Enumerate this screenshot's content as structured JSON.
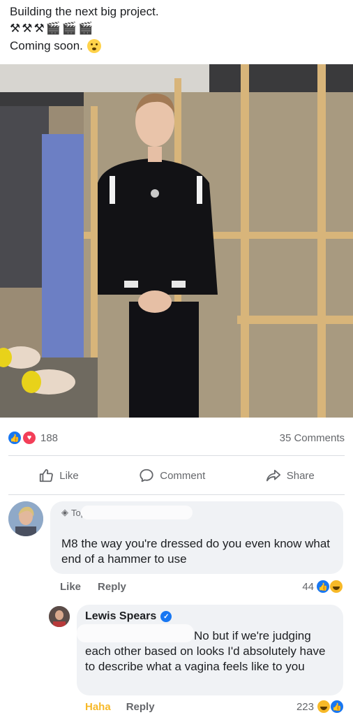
{
  "post": {
    "line1": "Building the next big project.",
    "emojis": [
      "⚒",
      "⚒",
      "⚒",
      "🎬",
      "🎬",
      "🎬"
    ],
    "line2": "Coming soon."
  },
  "stats": {
    "reactions": "188",
    "comments": "35 Comments"
  },
  "actions": {
    "like": "Like",
    "comment": "Comment",
    "share": "Share"
  },
  "comment1": {
    "tag": "Top Fan",
    "text": "M8 the way you're dressed do you even know what end of a hammer to use",
    "like": "Like",
    "reply": "Reply",
    "reaction_count": "44"
  },
  "comment2": {
    "author": "Lewis Spears",
    "text": "No but if we're judging each other based on looks I'd absolutely have to describe what a vagina feels like to you",
    "reaction": "Haha",
    "reply": "Reply",
    "reaction_count": "223"
  }
}
